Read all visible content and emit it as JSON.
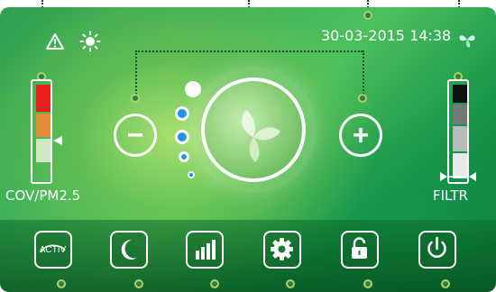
{
  "status": {
    "datetime": "30-03-2015 14:38",
    "alert_icon": "warning-triangle-icon",
    "sun_icon": "sun-icon",
    "fan_icon": "fan-icon"
  },
  "left_gauge": {
    "label": "COV/PM2.5",
    "colors": [
      "#e82020",
      "#e38a34",
      "#cfe8c4"
    ]
  },
  "right_gauge": {
    "label": "FILTR",
    "colors": [
      "#111111",
      "#777777",
      "#bbbbbb",
      "#e8e8e8"
    ]
  },
  "controls": {
    "minus_icon": "minus-icon",
    "plus_icon": "plus-icon",
    "center_icon": "leaf-logo-icon"
  },
  "bottom_bar": {
    "activ_label": "ACTIV",
    "buttons": [
      "activ-icon",
      "moon-icon",
      "bar-chart-icon",
      "gear-icon",
      "lock-open-icon",
      "power-icon"
    ]
  }
}
